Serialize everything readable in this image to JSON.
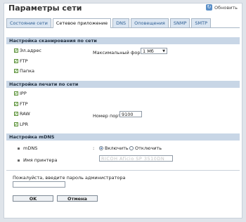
{
  "header": {
    "title": "Параметры сети",
    "refresh_label": "Обновить"
  },
  "tabs": [
    {
      "label": "Состояние сети"
    },
    {
      "label": "Сетевое приложение"
    },
    {
      "label": "DNS"
    },
    {
      "label": "Оповещения"
    },
    {
      "label": "SNMP"
    },
    {
      "label": "SMTP"
    }
  ],
  "active_tab_index": 1,
  "scan": {
    "header": "Настройка сканирования по сети",
    "items": [
      {
        "label": "Эл.адрес",
        "checked": true
      },
      {
        "label": "FTP",
        "checked": true
      },
      {
        "label": "Папка",
        "checked": true
      }
    ],
    "max_format_label": "Максимальный формат",
    "max_format_value": "1 Мб"
  },
  "print": {
    "header": "Настройка печати по сети",
    "items": [
      {
        "label": "IPP",
        "checked": true
      },
      {
        "label": "FTP",
        "checked": true
      },
      {
        "label": "RAW",
        "checked": true
      },
      {
        "label": "LPR",
        "checked": true
      }
    ],
    "port_label": "Номер порта",
    "port_value": "9100"
  },
  "mdns": {
    "header": "Настройка mDNS",
    "mdns_label": "mDNS",
    "colon": ":",
    "enable_label": "Включить",
    "disable_label": "Отключить",
    "enabled": true,
    "printer_name_label": "Имя принтера",
    "printer_name_value": "RICOH Aficio SP 3510DN [XXXXXX]"
  },
  "password": {
    "prompt": "Пожалуйста, введите пароль администратора",
    "value": ""
  },
  "buttons": {
    "ok": "OK",
    "cancel": "Отмена"
  },
  "colors": {
    "section_header": "#c8d6e6",
    "tab_bg": "#dbe6f2",
    "check_green": "#2e7d1a"
  }
}
